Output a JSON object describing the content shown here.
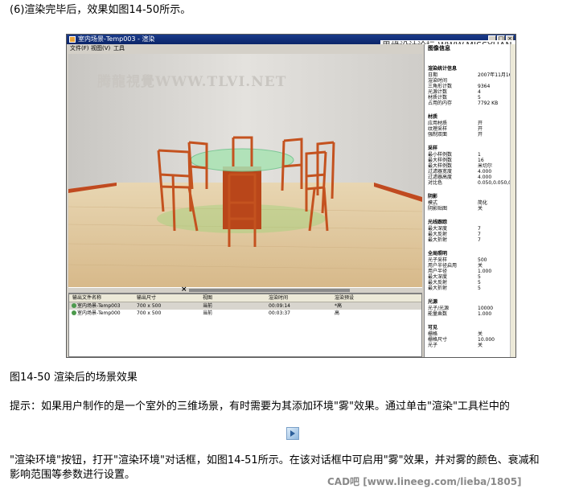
{
  "article": {
    "step_text": "(6)渲染完毕后，效果如图14-50所示。",
    "caption": "图14-50 渲染后的场景效果",
    "tip_line1": "提示：如果用户制作的是一个室外的三维场景，有时需要为其添加环境\"雾\"效果。通过单击\"渲染\"工具栏中的",
    "tip_line2": "\"渲染环境\"按钮，打开\"渲染环境\"对话框，如图14-51所示。在该对话框中可启用\"雾\"效果，并对雾的颜色、衰减和",
    "tip_line3": "影响范围等参数进行设置。",
    "icon": "render-environment-button-icon"
  },
  "watermarks": {
    "top": "思缘设计论坛 WWW.MISSYUAN.COM",
    "tlvi": "腾龍視覺WWW.TLVI.NET",
    "bottom": "CAD吧 [www.lineeg.com/lieba/1805]"
  },
  "window": {
    "title": "室内场景-Temp003 - 渲染",
    "menu": [
      "文件(F)",
      "视图(V)",
      "工具"
    ],
    "buttons": [
      "_",
      "□",
      "×"
    ]
  },
  "history": {
    "headers": [
      "输出文件名称",
      "输出尺寸",
      "视图",
      "渲染时间",
      "渲染预设"
    ],
    "rows": [
      {
        "name": "室内场景-Temp003",
        "size": "700 x 500",
        "view": "当前",
        "time": "00:09:14",
        "preset": "*高"
      },
      {
        "name": "室内场景-Temp000",
        "size": "700 x 500",
        "view": "当前",
        "time": "00:03:37",
        "preset": "高"
      }
    ]
  },
  "info": {
    "header": "图像信息",
    "sections": [
      {
        "title": "渲染统计信息",
        "rows": [
          [
            "日期",
            "2007年11月16"
          ],
          [
            "渲染时间",
            ""
          ],
          [
            "三角形计数",
            "9364"
          ],
          [
            "光源计数",
            "4"
          ],
          [
            "材质计数",
            "5"
          ],
          [
            "占用的内存",
            "7792 KB"
          ]
        ]
      },
      {
        "title": "材质",
        "rows": [
          [
            "应用材质",
            "开"
          ],
          [
            "纹理采样",
            "开"
          ],
          [
            "强制双面",
            "开"
          ]
        ]
      },
      {
        "title": "采样",
        "rows": [
          [
            "最小样例数",
            "1"
          ],
          [
            "最大样例数",
            "16"
          ],
          [
            "最大样例数",
            "米切尔"
          ],
          [
            "过滤器宽度",
            "4.000"
          ],
          [
            "过滤器高度",
            "4.000"
          ],
          [
            "对比色",
            "0.050,0.050,0"
          ]
        ]
      },
      {
        "title": "阴影",
        "rows": [
          [
            "模式",
            "简化"
          ],
          [
            "阴影贴图",
            "关"
          ]
        ]
      },
      {
        "title": "光线跟踪",
        "rows": [
          [
            "最大深度",
            "7"
          ],
          [
            "最大反射",
            "7"
          ],
          [
            "最大折射",
            "7"
          ]
        ]
      },
      {
        "title": "全局照明",
        "rows": [
          [
            "光子采样",
            "500"
          ],
          [
            "用户半径启用",
            "关"
          ],
          [
            "用户半径",
            "1.000"
          ],
          [
            "最大深度",
            "5"
          ],
          [
            "最大反射",
            "5"
          ],
          [
            "最大折射",
            "5"
          ]
        ]
      },
      {
        "title": "光源",
        "rows": [
          [
            "光子/光源",
            "10000"
          ],
          [
            "能量乘数",
            "1.000"
          ]
        ]
      },
      {
        "title": "可见",
        "rows": [
          [
            "栅格",
            "关"
          ],
          [
            "栅格尺寸",
            "10.000"
          ],
          [
            "光子",
            "关"
          ]
        ]
      }
    ]
  }
}
